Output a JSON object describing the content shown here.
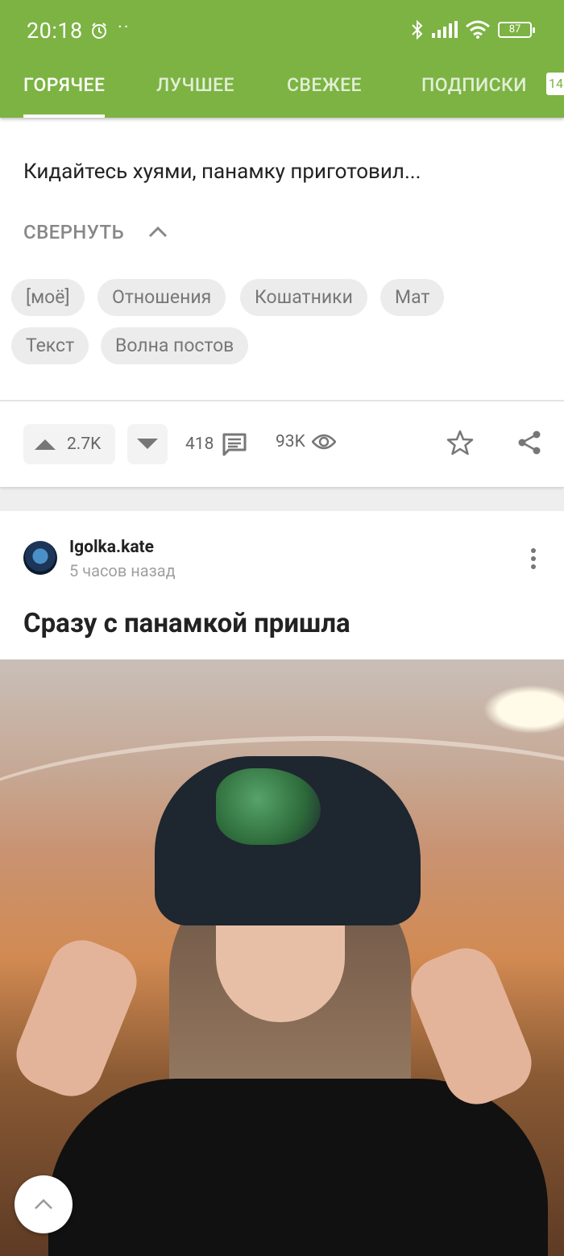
{
  "status_bar": {
    "time": "20:18",
    "battery": "87"
  },
  "tabs": [
    {
      "label": "ГОРЯЧЕЕ",
      "active": true
    },
    {
      "label": "ЛУЧШЕЕ",
      "active": false
    },
    {
      "label": "СВЕЖЕЕ",
      "active": false
    },
    {
      "label": "ПОДПИСКИ",
      "active": false
    }
  ],
  "tab_badge": "14",
  "post1": {
    "body": "Кидайтесь хуями, панамку приготовил...",
    "collapse_label": "СВЕРНУТЬ",
    "tags": [
      "[моё]",
      "Отношения",
      "Кошатники",
      "Мат",
      "Текст",
      "Волна постов"
    ],
    "rating": "2.7K",
    "comments": "418",
    "views": "93K"
  },
  "post2": {
    "author": "Igolka.kate",
    "time_ago": "5 часов назад",
    "title": "Сразу с панамкой пришла"
  },
  "colors": {
    "accent": "#7cb343"
  }
}
